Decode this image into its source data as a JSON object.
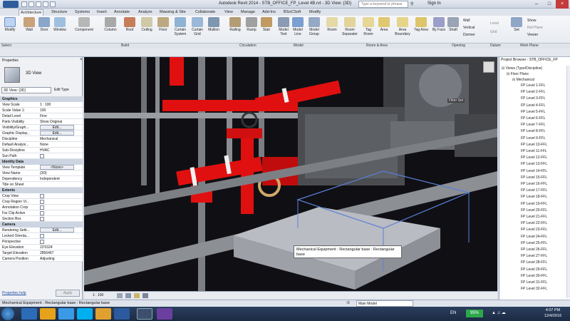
{
  "app": {
    "title": "Autodesk Revit 2014 - STB_OFFICE_FP_Level 4B.rvt - 3D View: {3D}",
    "search_placeholder": "Type a keyword or phrase",
    "sign_in": "Sign In"
  },
  "tabs": [
    "Architecture",
    "Structure",
    "Systems",
    "Insert",
    "Annotate",
    "Analyze",
    "Massing & Site",
    "Collaborate",
    "View",
    "Manage",
    "Add-Ins",
    "BSoCSoft",
    "Modify"
  ],
  "ribbon": {
    "buttons": [
      "Modify",
      "Wall",
      "Door",
      "Window",
      "Component",
      "Column",
      "Roof",
      "Ceiling",
      "Floor",
      "Curtain System",
      "Curtain Grid",
      "Mullion",
      "Railing",
      "Ramp",
      "Stair",
      "Model Text",
      "Model Line",
      "Model Group",
      "Room",
      "Room Separator",
      "Tag Room",
      "Area",
      "Area Boundary",
      "Tag Area",
      "By Face",
      "Shaft",
      "Set"
    ],
    "small": [
      "Wall",
      "Vertical",
      "Dormer",
      "Level",
      "Grid",
      "Show",
      "Ref Plane",
      "Viewer"
    ],
    "panels": [
      "Select",
      "Build",
      "Circulation",
      "Model",
      "Room & Area",
      "Opening",
      "Datum",
      "Work Plane"
    ]
  },
  "properties": {
    "title": "Properties",
    "type_name": "3D View",
    "selector": "3D View: {3D}",
    "edit_type": "Edit Type",
    "groups": [
      {
        "name": "Graphics",
        "rows": [
          {
            "k": "View Scale",
            "v": "1 : 100"
          },
          {
            "k": "Scale Value  1:",
            "v": "100"
          },
          {
            "k": "Detail Level",
            "v": "Fine"
          },
          {
            "k": "Parts Visibility",
            "v": "Show Original"
          },
          {
            "k": "Visibility/Graph...",
            "v": "Edit..."
          },
          {
            "k": "Graphic Display...",
            "v": "Edit..."
          },
          {
            "k": "Discipline",
            "v": "Mechanical"
          },
          {
            "k": "Default Analysi...",
            "v": "None"
          },
          {
            "k": "Sub-Discipline",
            "v": "HVAC"
          },
          {
            "k": "Sun Path",
            "v": ""
          }
        ]
      },
      {
        "name": "Identity Data",
        "rows": [
          {
            "k": "View Template",
            "v": "<None>"
          },
          {
            "k": "View Name",
            "v": "{3D}"
          },
          {
            "k": "Dependency",
            "v": "Independent"
          },
          {
            "k": "Title on Sheet",
            "v": ""
          }
        ]
      },
      {
        "name": "Extents",
        "rows": [
          {
            "k": "Crop View",
            "v": ""
          },
          {
            "k": "Crop Region Vi...",
            "v": ""
          },
          {
            "k": "Annotation Crop",
            "v": ""
          },
          {
            "k": "Far Clip Active",
            "v": ""
          },
          {
            "k": "Section Box",
            "v": ""
          }
        ]
      },
      {
        "name": "Camera",
        "rows": [
          {
            "k": "Rendering Setti...",
            "v": "Edit..."
          },
          {
            "k": "Locked Orienta...",
            "v": ""
          },
          {
            "k": "Perspective",
            "v": ""
          },
          {
            "k": "Eye Elevation",
            "v": "22'0324"
          },
          {
            "k": "Target Elevation",
            "v": "2856467"
          },
          {
            "k": "Camera Position",
            "v": "Adjusting"
          }
        ]
      }
    ],
    "help_link": "Properties help",
    "apply": "Apply"
  },
  "viewport": {
    "tooltip_line1": "Mechanical Equipment : Rectangular base : Rectangular",
    "tooltip_line2": "base",
    "label_filter": "Filter Set",
    "scale": "1 : 100"
  },
  "browser": {
    "title": "Project Browser - STB_OFFICE_FP",
    "root": "Views (Type/Discipline)",
    "floor_plans": "Floor Plans",
    "mechanical": "Mechanical",
    "items": [
      "FP Level 1-FFL",
      "FP Level 2-FFL",
      "FP Level 3-FFL",
      "FP Level 4-FFL",
      "FP Level 5-FFL",
      "FP Level 6-FFL",
      "FP Level 7-FFL",
      "FP Level 8-FFL",
      "FP Level 9-FFL",
      "FP Level 10-FFL",
      "FP Level 11-FFL",
      "FP Level 12-FFL",
      "FP Level 13-FFL",
      "FP Level 14-FFL",
      "FP Level 15-FFL",
      "FP Level 16-FFL",
      "FP Level 17-FFL",
      "FP Level 18-FFL",
      "FP Level 19-FFL",
      "FP Level 20-FFL",
      "FP Level 21-FFL",
      "FP Level 22-FFL",
      "FP Level 23-FFL",
      "FP Level 24-FFL",
      "FP Level 25-FFL",
      "FP Level 26-FFL",
      "FP Level 27-FFL",
      "FP Level 28-FFL",
      "FP Level 29-FFL",
      "FP Level 30-FFL",
      "FP Level 31-FFL",
      "FP Level 32-FFL"
    ]
  },
  "statusbar": {
    "text": "Mechanical Equipment : Rectangular base : Rectangular base",
    "zero": ":0",
    "model": "Main Model"
  },
  "taskbar": {
    "lang": "EN",
    "battery": "95%",
    "time": "4:07 PM",
    "date": "12/4/2016"
  },
  "colors": {
    "accent": "#2f5d9c",
    "pipe_red": "#e01010",
    "steel": "#8c8f94"
  }
}
